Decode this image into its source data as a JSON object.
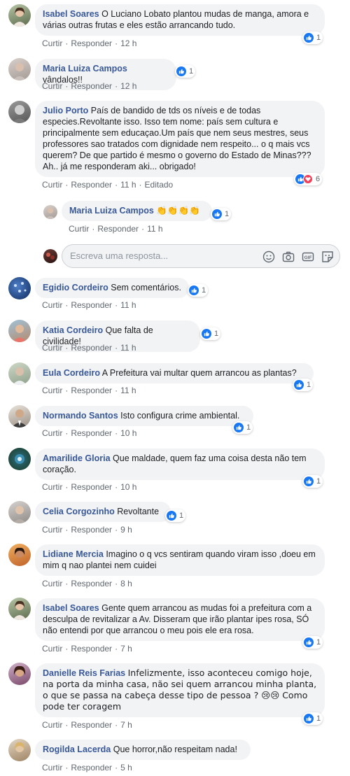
{
  "actions": {
    "like": "Curtir",
    "reply": "Responder",
    "edited": "Editado"
  },
  "reply_input": {
    "placeholder": "Escreva uma resposta..."
  },
  "comments": [
    {
      "author": "Isabel Soares",
      "text": "O Luciano Lobato plantou mudas de manga, amora e várias outras frutas e eles estão arrancando tudo.",
      "time": "12 h",
      "reactions": "1"
    },
    {
      "author": "Maria Luiza Campos",
      "text": "vândalos!!",
      "time": "12 h",
      "reactions": "1"
    },
    {
      "author": "Julio Porto",
      "text": "País de bandido de tds os níveis e de todas especies.Revoltante isso. Isso tem nome: país sem cultura e principalmente sem educaçao.Um país que nem seus mestres, seus professores sao tratados com dignidade nem respeito... o q mais vcs querem? De que partido é mesmo o governo do Estado de Minas??? Ah.. já me responderam aki... obrigado!",
      "time": "11 h",
      "reactions": "6"
    },
    {
      "author": "Maria Luiza Campos",
      "text": "👏👏👏👏",
      "time": "11 h",
      "reactions": "1"
    },
    {
      "author": "Egidio Cordeiro",
      "text": "Sem comentários.",
      "time": "11 h",
      "reactions": "1"
    },
    {
      "author": "Katia Cordeiro",
      "text": "Que falta de civilidade!",
      "time": "11 h",
      "reactions": "1"
    },
    {
      "author": "Eula Cordeiro",
      "text": "A Prefeitura vai multar quem arrancou as plantas?",
      "time": "11 h",
      "reactions": "1"
    },
    {
      "author": "Normando Santos",
      "text": "Isto configura crime ambiental.",
      "time": "10 h",
      "reactions": "1"
    },
    {
      "author": "Amarilide Gloria",
      "text": "Que maldade, quem faz uma coisa desta não tem coração.",
      "time": "10 h",
      "reactions": "1"
    },
    {
      "author": "Celia Corgozinho",
      "text": "Revoltante",
      "time": "9 h",
      "reactions": "1"
    },
    {
      "author": "Lidiane Mercia",
      "text": "Imagino o q vcs sentiram quando viram isso ,doeu em mim q nao plantei nem cuidei",
      "time": "8 h",
      "reactions": ""
    },
    {
      "author": "Isabel Soares",
      "text": "Gente quem arrancou as mudas foi a prefeitura com a desculpa de revitalizar a Av. Disseram que irão plantar ipes rosa, SÓ não entendi por que arrancou o meu pois ele era rosa.",
      "time": "7 h",
      "reactions": "1"
    },
    {
      "author": "Danielle Reis Farias",
      "text": "Infelizmente, isso aconteceu comigo hoje, na porta da minha casa, não sei quem arrancou minha planta, o que se passa na cabeça desse tipo de pessoa ? 😢😢 Como pode ter coragem",
      "time": "7 h",
      "reactions": "1"
    },
    {
      "author": "Rogilda Lacerda",
      "text": "Que horror,não respeitam nada!",
      "time": "5 h",
      "reactions": ""
    }
  ],
  "colors": {
    "author": "#385898",
    "bubble": "#f2f3f5",
    "like": "#1877f2",
    "love": "#f33e58"
  },
  "icons": [
    "thumbs-up-icon",
    "heart-icon",
    "emoji-icon",
    "camera-icon",
    "gif-icon",
    "sticker-icon"
  ]
}
